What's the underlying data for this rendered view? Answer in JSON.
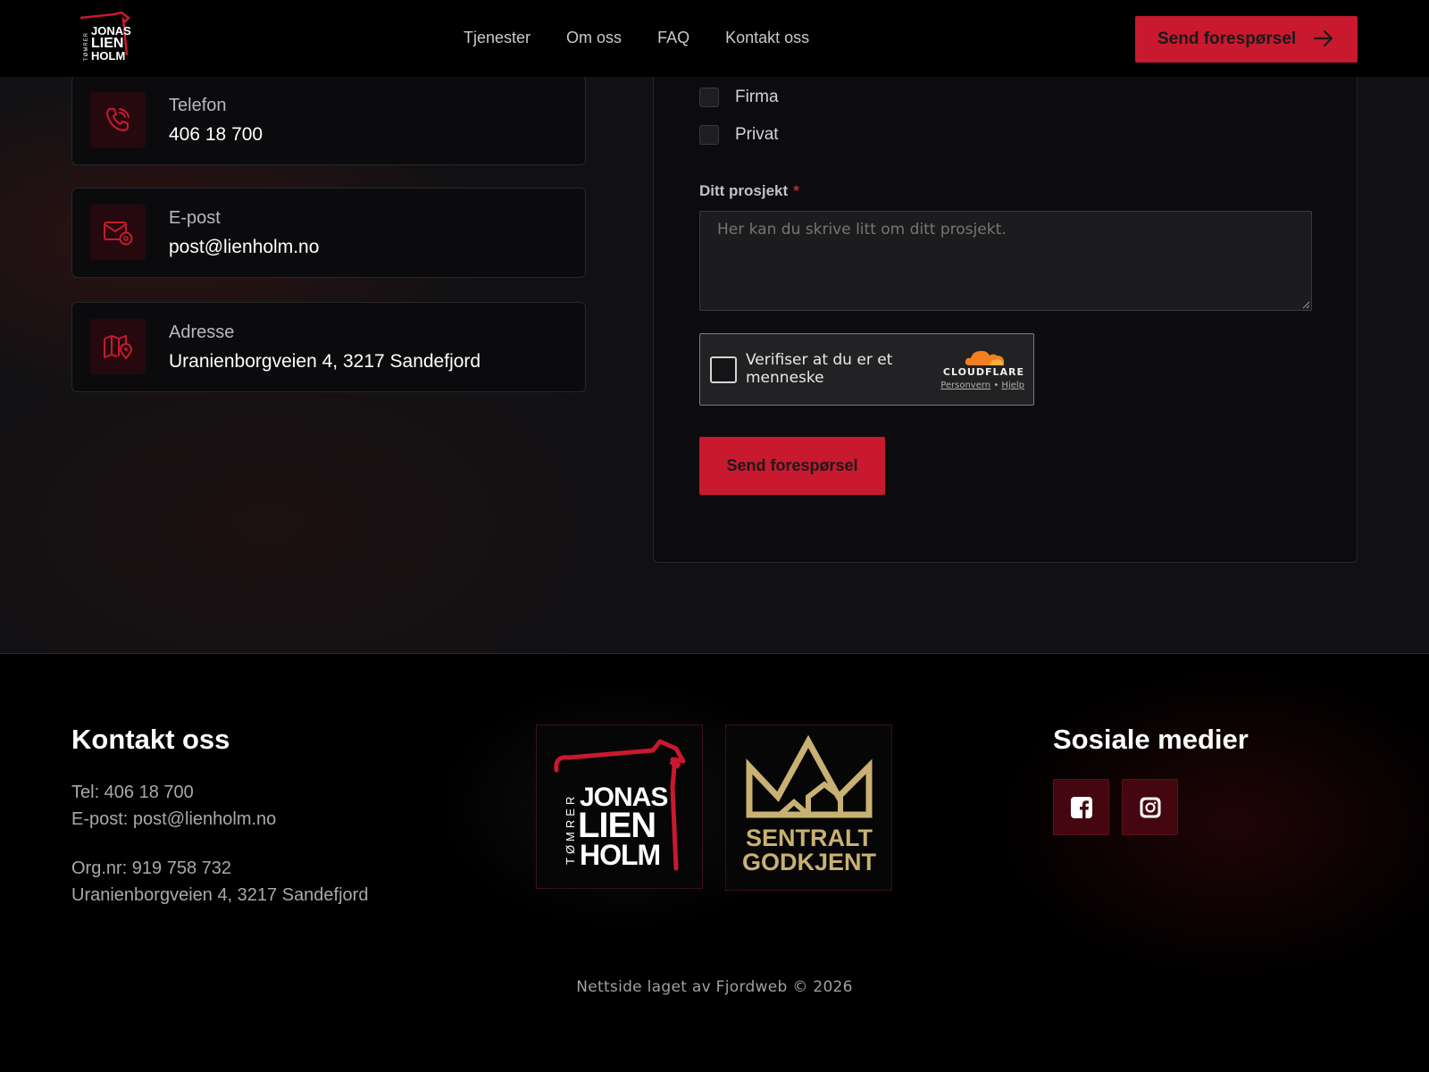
{
  "header": {
    "logo": {
      "line1": "JONAS",
      "line2": "LIEN",
      "line3": "HOLM",
      "side": "TØMRER"
    },
    "nav": [
      "Tjenester",
      "Om oss",
      "FAQ",
      "Kontakt oss"
    ],
    "cta_label": "Send forespørsel"
  },
  "contact_cards": [
    {
      "label": "Telefon",
      "value": "406 18 700",
      "icon": "phone-icon"
    },
    {
      "label": "E-post",
      "value": "post@lienholm.no",
      "icon": "mail-icon"
    },
    {
      "label": "Adresse",
      "value": "Uranienborgveien 4, 3217 Sandefjord",
      "icon": "map-icon"
    }
  ],
  "form": {
    "checkboxes": [
      {
        "label": "Firma",
        "checked": false
      },
      {
        "label": "Privat",
        "checked": false
      }
    ],
    "project_label": "Ditt prosjekt",
    "required_mark": "*",
    "project_placeholder": "Her kan du skrive litt om ditt prosjekt.",
    "captcha": {
      "text": "Verifiser at du er et menneske",
      "brand": "CLOUDFLARE",
      "privacy": "Personvern",
      "separator": "•",
      "help": "Hjelp"
    },
    "submit_label": "Send forespørsel"
  },
  "footer": {
    "contact_heading": "Kontakt oss",
    "tel": "Tel: 406 18 700",
    "email": "E-post: post@lienholm.no",
    "orgnr": "Org.nr: 919 758 732",
    "address": "Uranienborgveien 4, 3217 Sandefjord",
    "logo": {
      "line1": "JONAS",
      "line2": "LIEN",
      "line3": "HOLM",
      "side": "TØMRER"
    },
    "badge": {
      "line1": "SENTRALT",
      "line2": "GODKJENT"
    },
    "social_heading": "Sosiale medier",
    "social": [
      "facebook-icon",
      "instagram-icon"
    ],
    "credit": "Nettside laget av Fjordweb © 2026"
  },
  "colors": {
    "accent": "#c8192f",
    "gold": "#c9b173",
    "bg": "#111113"
  }
}
